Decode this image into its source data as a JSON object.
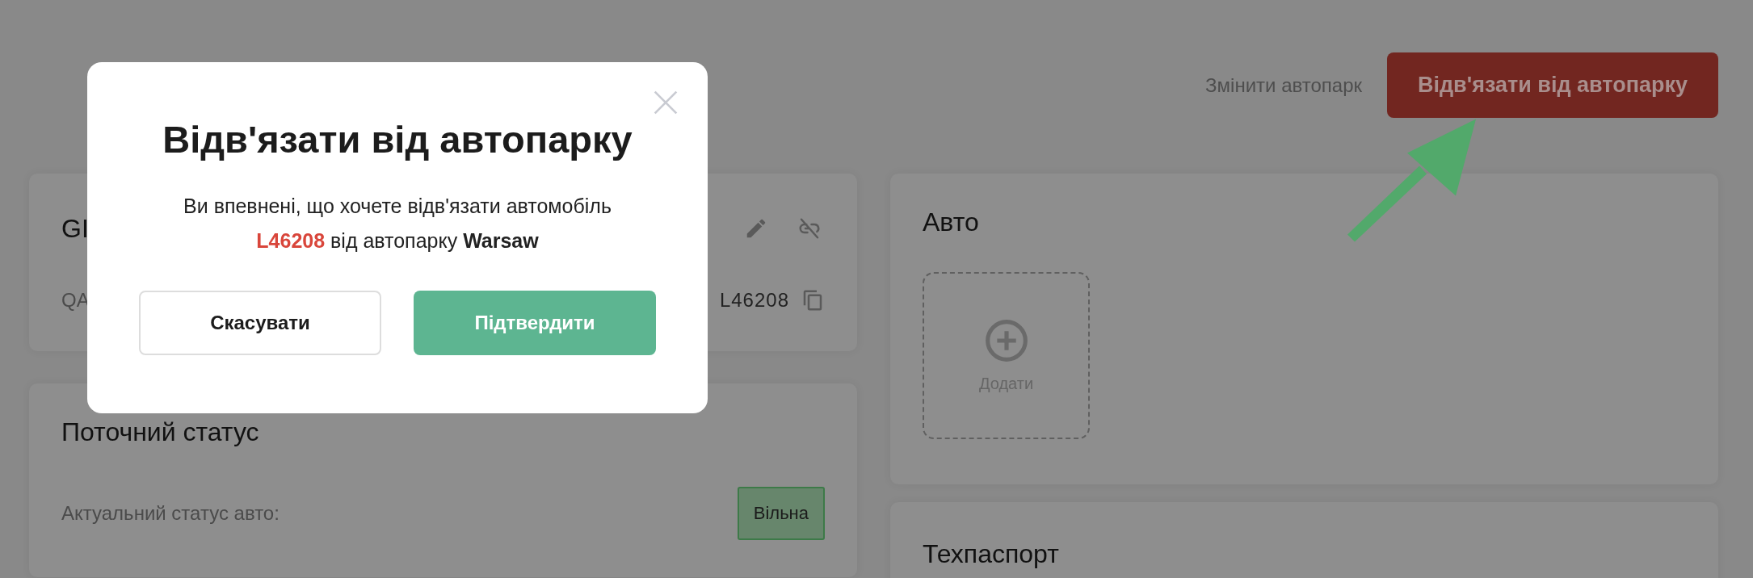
{
  "toolbar": {
    "change_fleet_link": "Змінити автопарк",
    "unlink_button": "Відв'язати від автопарку"
  },
  "vehicle_card": {
    "title": "GI",
    "subtitle": "QA",
    "plate": "L46208"
  },
  "status_card": {
    "title": "Поточний статус",
    "label": "Актуальний статус авто:",
    "status": "Вільна"
  },
  "photos_card": {
    "title": "Авто",
    "add_label": "Додати"
  },
  "registration_card": {
    "title": "Техпаспорт"
  },
  "dialog": {
    "title": "Відв'язати від автопарку",
    "message": "Ви впевнені, що хочете відв'язати автомобіль **L46208** від автопарку **Warsaw**",
    "buttons": [
      {
        "label": "Скасувати",
        "kind": "secondary"
      },
      {
        "label": "Підтвердити",
        "kind": "primary"
      }
    ]
  }
}
